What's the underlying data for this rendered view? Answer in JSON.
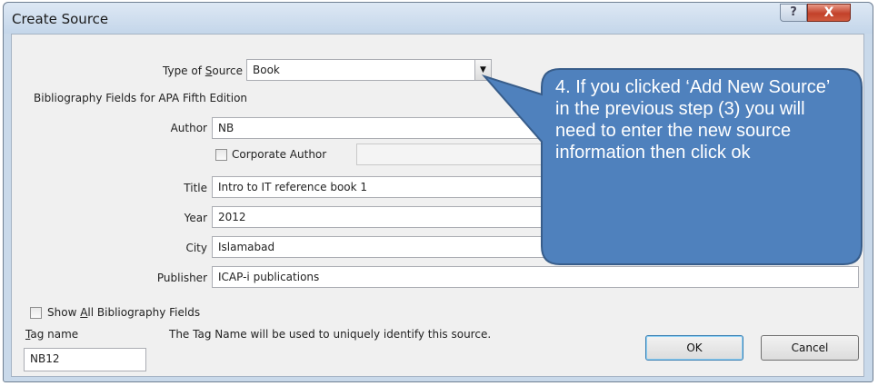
{
  "window": {
    "title": "Create Source",
    "help_label": "?",
    "close_label": "X"
  },
  "form": {
    "type_of_source": {
      "label_pre": "Type of ",
      "label_u": "S",
      "label_post": "ource",
      "value": "Book"
    },
    "section_title": "Bibliography Fields for APA Fifth Edition",
    "author": {
      "label": "Author",
      "value": "NB"
    },
    "corporate_author": {
      "label": "Corporate Author",
      "checked": false,
      "value": ""
    },
    "title": {
      "label": "Title",
      "value": "Intro to IT reference book 1"
    },
    "year": {
      "label": "Year",
      "value": "2012"
    },
    "city": {
      "label": "City",
      "value": "Islamabad"
    },
    "publisher": {
      "label": "Publisher",
      "value": "ICAP-i publications"
    }
  },
  "show_all": {
    "label_pre": "Show ",
    "label_u": "A",
    "label_post": "ll Bibliography Fields",
    "checked": false
  },
  "tag": {
    "label_u": "T",
    "label_post": "ag name",
    "value": "NB12",
    "hint": "The Tag Name will be used to uniquely identify this source."
  },
  "buttons": {
    "ok": "OK",
    "cancel": "Cancel"
  },
  "callout": {
    "text": "4. If you clicked ‘Add New Source’ in the previous step (3) you will need to enter the new source information then click ok",
    "fill": "#4f81bd",
    "stroke": "#385d8a"
  },
  "icons": {
    "dropdown": "chevron-down-icon",
    "help": "help-icon",
    "close": "close-icon"
  }
}
